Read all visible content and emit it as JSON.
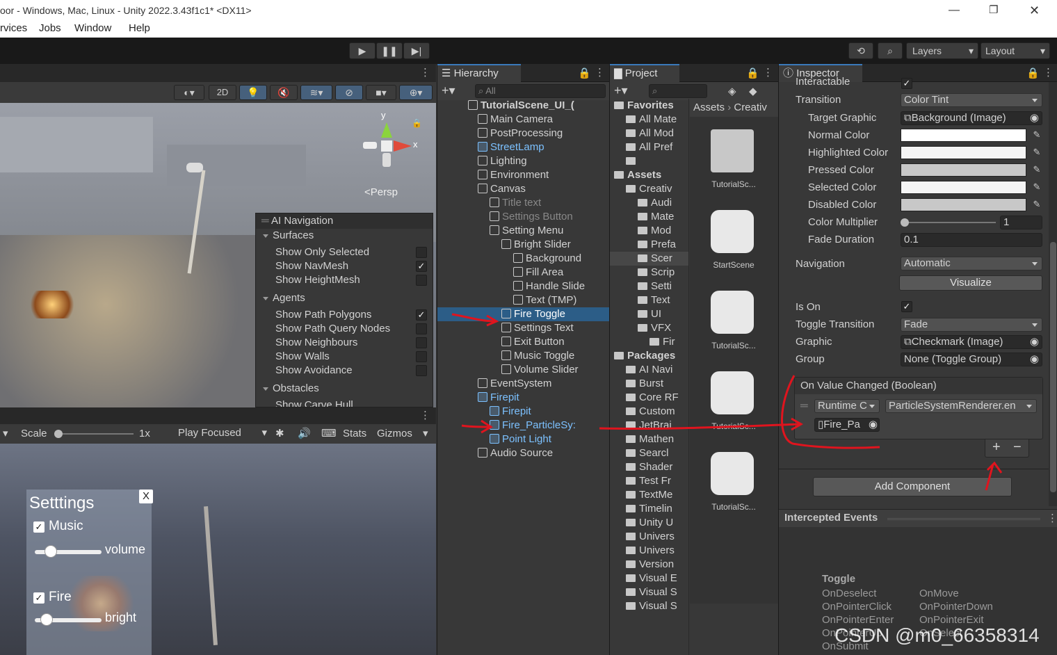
{
  "window": {
    "title": "oor - Windows, Mac, Linux - Unity 2022.3.43f1c1* <DX11>"
  },
  "menu": [
    "rvices",
    "Jobs",
    "Window",
    "Help"
  ],
  "toolbar": {
    "layers": "Layers",
    "layout": "Layout"
  },
  "scene": {
    "toolbar": {
      "mode_2d": "2D"
    },
    "persp": "Persp",
    "gizmo_y": "y",
    "gizmo_x": "x",
    "nav_overlay": {
      "title": "AI Navigation",
      "surfaces": "Surfaces",
      "surface_items": [
        {
          "label": "Show Only Selected",
          "checked": false
        },
        {
          "label": "Show NavMesh",
          "checked": true
        },
        {
          "label": "Show HeightMesh",
          "checked": false
        }
      ],
      "agents": "Agents",
      "agent_items": [
        {
          "label": "Show Path Polygons",
          "checked": true
        },
        {
          "label": "Show Path Query Nodes",
          "checked": false
        },
        {
          "label": "Show Neighbours",
          "checked": false
        },
        {
          "label": "Show Walls",
          "checked": false
        },
        {
          "label": "Show Avoidance",
          "checked": false
        }
      ],
      "obstacles": "Obstacles",
      "obstacle_items": [
        {
          "label": "Show Carve Hull",
          "checked": false
        }
      ]
    }
  },
  "game": {
    "toolbar": {
      "scale": "Scale",
      "scale_value": "1x",
      "play_focused": "Play Focused",
      "stats": "Stats",
      "gizmos": "Gizmos"
    },
    "settings_panel": {
      "title": "Setttings",
      "close": "X",
      "music": "Music",
      "volume": "volume",
      "fire": "Fire",
      "bright": "bright"
    }
  },
  "hierarchy": {
    "tab": "Hierarchy",
    "search_placeholder": "All",
    "items": [
      {
        "label": "TutorialScene_UI_(",
        "depth": 0,
        "style": "scene"
      },
      {
        "label": "Main Camera",
        "depth": 1
      },
      {
        "label": "PostProcessing",
        "depth": 1
      },
      {
        "label": "StreetLamp",
        "depth": 1,
        "style": "prefab"
      },
      {
        "label": "Lighting",
        "depth": 1
      },
      {
        "label": "Environment",
        "depth": 1
      },
      {
        "label": "Canvas",
        "depth": 1
      },
      {
        "label": "Title text",
        "depth": 2,
        "style": "dim"
      },
      {
        "label": "Settings Button",
        "depth": 2,
        "style": "dim"
      },
      {
        "label": "Setting Menu",
        "depth": 2
      },
      {
        "label": "Bright Slider",
        "depth": 3
      },
      {
        "label": "Background",
        "depth": 4
      },
      {
        "label": "Fill Area",
        "depth": 4
      },
      {
        "label": "Handle Slide",
        "depth": 4
      },
      {
        "label": "Text (TMP)",
        "depth": 4
      },
      {
        "label": "Fire Toggle",
        "depth": 3,
        "style": "selected"
      },
      {
        "label": "Settings Text",
        "depth": 3
      },
      {
        "label": "Exit Button",
        "depth": 3
      },
      {
        "label": "Music Toggle",
        "depth": 3
      },
      {
        "label": "Volume Slider",
        "depth": 3
      },
      {
        "label": "EventSystem",
        "depth": 1
      },
      {
        "label": "Firepit",
        "depth": 1,
        "style": "prefab"
      },
      {
        "label": "Firepit",
        "depth": 2,
        "style": "prefab"
      },
      {
        "label": "Fire_ParticleSy:",
        "depth": 2,
        "style": "prefab"
      },
      {
        "label": "Point Light",
        "depth": 2,
        "style": "prefab"
      },
      {
        "label": "Audio Source",
        "depth": 1
      }
    ]
  },
  "project": {
    "tab": "Project",
    "breadcrumb": [
      "Assets",
      "Creativ"
    ],
    "tree": [
      {
        "label": "Favorites",
        "depth": 0,
        "bold": true
      },
      {
        "label": "All Mate",
        "depth": 1
      },
      {
        "label": "All Mod",
        "depth": 1
      },
      {
        "label": "All Pref",
        "depth": 1
      },
      {
        "label": "",
        "depth": 1
      },
      {
        "label": "Assets",
        "depth": 0,
        "bold": true
      },
      {
        "label": "Creativ",
        "depth": 1
      },
      {
        "label": "Audi",
        "depth": 2
      },
      {
        "label": "Mate",
        "depth": 2
      },
      {
        "label": "Mod",
        "depth": 2
      },
      {
        "label": "Prefa",
        "depth": 2
      },
      {
        "label": "Scer",
        "depth": 2
      },
      {
        "label": "Scrip",
        "depth": 2
      },
      {
        "label": "Setti",
        "depth": 2
      },
      {
        "label": "Text",
        "depth": 2
      },
      {
        "label": "UI",
        "depth": 2
      },
      {
        "label": "VFX",
        "depth": 2
      },
      {
        "label": "Fir",
        "depth": 3
      },
      {
        "label": "Packages",
        "depth": 0,
        "bold": true
      },
      {
        "label": "AI Navi",
        "depth": 1
      },
      {
        "label": "Burst",
        "depth": 1
      },
      {
        "label": "Core RF",
        "depth": 1
      },
      {
        "label": "Custom",
        "depth": 1
      },
      {
        "label": "JetBrai",
        "depth": 1
      },
      {
        "label": "Mathen",
        "depth": 1
      },
      {
        "label": "Searcl",
        "depth": 1
      },
      {
        "label": "Shader",
        "depth": 1
      },
      {
        "label": "Test Fr",
        "depth": 1
      },
      {
        "label": "TextMe",
        "depth": 1
      },
      {
        "label": "Timelin",
        "depth": 1
      },
      {
        "label": "Unity U",
        "depth": 1
      },
      {
        "label": "Univers",
        "depth": 1
      },
      {
        "label": "Univers",
        "depth": 1
      },
      {
        "label": "Version",
        "depth": 1
      },
      {
        "label": "Visual E",
        "depth": 1
      },
      {
        "label": "Visual S",
        "depth": 1
      },
      {
        "label": "Visual S",
        "depth": 1
      }
    ],
    "assets": [
      "TutorialSc...",
      "StartScene",
      "TutorialSc...",
      "TutorialSc...",
      "TutorialSc..."
    ]
  },
  "inspector": {
    "tab": "Inspector",
    "interactable": "Interactable",
    "transition": {
      "label": "Transition",
      "value": "Color Tint"
    },
    "target_graphic": {
      "label": "Target Graphic",
      "value": "Background (Image)"
    },
    "colors": [
      {
        "label": "Normal Color",
        "value": "#ffffff"
      },
      {
        "label": "Highlighted Color",
        "value": "#f5f5f5"
      },
      {
        "label": "Pressed Color",
        "value": "#c8c8c8"
      },
      {
        "label": "Selected Color",
        "value": "#f5f5f5"
      },
      {
        "label": "Disabled Color",
        "value": "#c8c8c8"
      }
    ],
    "color_multiplier": {
      "label": "Color Multiplier",
      "value": "1"
    },
    "fade_duration": {
      "label": "Fade Duration",
      "value": "0.1"
    },
    "navigation": {
      "label": "Navigation",
      "value": "Automatic"
    },
    "visualize": "Visualize",
    "is_on": {
      "label": "Is On",
      "checked": true
    },
    "toggle_transition": {
      "label": "Toggle Transition",
      "value": "Fade"
    },
    "graphic": {
      "label": "Graphic",
      "value": "Checkmark (Image)"
    },
    "group": {
      "label": "Group",
      "value": "None (Toggle Group)"
    },
    "event": {
      "title": "On Value Changed (Boolean)",
      "runtime": "Runtime C",
      "function": "ParticleSystemRenderer.en",
      "object": "Fire_Pa"
    },
    "plus": "+",
    "minus": "−",
    "add_component": "Add Component",
    "intercepted": {
      "title": "Intercepted Events",
      "header": "Toggle",
      "col1": [
        "OnDeselect",
        "OnPointerClick",
        "OnPointerEnter",
        "OnPointerUp",
        "OnSubmit"
      ],
      "col2": [
        "OnMove",
        "OnPointerDown",
        "OnPointerExit",
        "OnSelect"
      ]
    }
  },
  "watermark": "CSDN @m0_66358314",
  "colors": {
    "accent": "#3a79bb",
    "selection": "#2c5d87",
    "prefab": "#7cc1ff",
    "annotation": "#e0141e"
  }
}
